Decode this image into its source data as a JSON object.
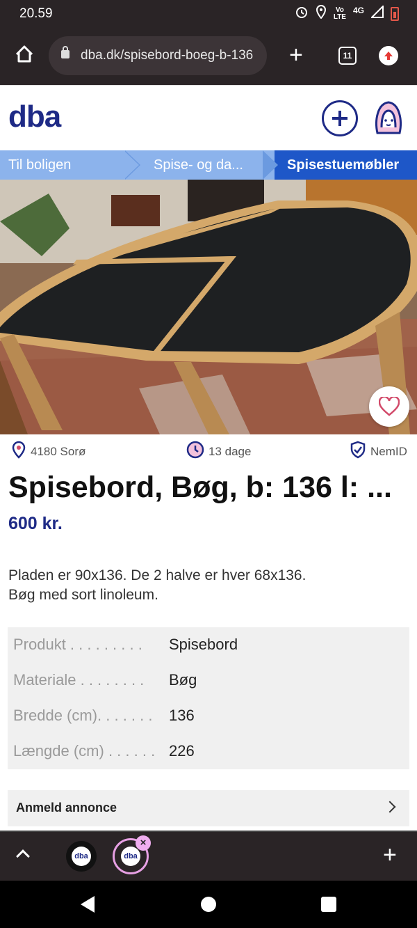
{
  "status_bar": {
    "time": "20.59",
    "network_top": "Vo",
    "network_bottom": "LTE",
    "signal": "4G"
  },
  "browser": {
    "url": "dba.dk/spisebord-boeg-b-136",
    "tab_count": "11"
  },
  "header": {
    "logo": "dba"
  },
  "breadcrumb": {
    "items": [
      "Til boligen",
      "Spise- og da...",
      "Spisestuemøbler"
    ]
  },
  "listing": {
    "location": "4180 Sorø",
    "age": "13 dage",
    "verification": "NemID",
    "title": "Spisebord, Bøg, b: 136 l: ...",
    "price": "600 kr.",
    "description_line1": "Pladen er 90x136. De 2 halve er hver 68x136.",
    "description_line2": "Bøg med sort linoleum.",
    "specs": [
      {
        "key": "Produkt . . . . . . . . .",
        "value": "Spisebord"
      },
      {
        "key": "Materiale . . . . . . . .",
        "value": "Bøg"
      },
      {
        "key": "Bredde (cm). . . . . . .",
        "value": "136"
      },
      {
        "key": "Længde (cm) . . . . . .",
        "value": "226"
      }
    ],
    "report_label": "Anmeld annonce"
  },
  "tab_strip": {
    "tab_a_label": "dba",
    "tab_b_label": "dba",
    "close_glyph": "×"
  },
  "colors": {
    "brand": "#1e2a86",
    "breadcrumb_active": "#1e57c8",
    "breadcrumb_bg": "#8cb3ec",
    "chrome": "#2a2426"
  },
  "icons": [
    "home-icon",
    "lock-icon",
    "plus-icon",
    "tabs-icon",
    "update-icon",
    "create-listing-icon",
    "profile-icon",
    "heart-icon",
    "location-pin-icon",
    "clock-icon",
    "shield-check-icon",
    "chevron-right-icon",
    "chevron-up-icon",
    "close-icon",
    "back-icon",
    "home-circle-icon",
    "recents-icon"
  ]
}
